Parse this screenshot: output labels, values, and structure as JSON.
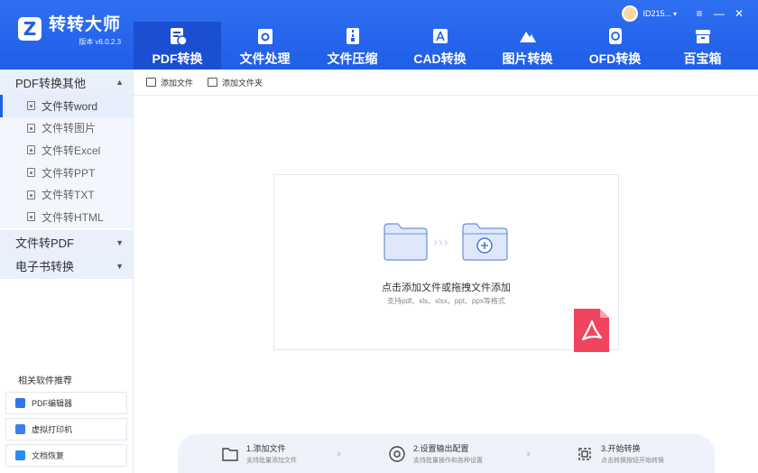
{
  "app": {
    "name": "转转大师",
    "version": "版本 v6.0.2.3",
    "logo_letter": "Z"
  },
  "user": {
    "id": "ID215...",
    "dropdown": "▾"
  },
  "window": {
    "menu": "≡",
    "minimize": "—",
    "close": "✕"
  },
  "nav_tabs": [
    {
      "label": "PDF转换",
      "icon": "pdf-convert-icon",
      "active": true
    },
    {
      "label": "文件处理",
      "icon": "file-process-icon"
    },
    {
      "label": "文件压缩",
      "icon": "file-compress-icon"
    },
    {
      "label": "CAD转换",
      "icon": "cad-icon"
    },
    {
      "label": "图片转换",
      "icon": "image-icon"
    },
    {
      "label": "OFD转换",
      "icon": "ofd-icon"
    },
    {
      "label": "百宝箱",
      "icon": "toolbox-icon"
    }
  ],
  "sidebar": {
    "groups": [
      {
        "label": "PDF转换其他",
        "caret": "▲",
        "items": [
          {
            "label": "文件转word",
            "active": true
          },
          {
            "label": "文件转图片"
          },
          {
            "label": "文件转Excel"
          },
          {
            "label": "文件转PPT"
          },
          {
            "label": "文件转TXT"
          },
          {
            "label": "文件转HTML"
          }
        ]
      },
      {
        "label": "文件转PDF",
        "caret": "▼"
      },
      {
        "label": "电子书转换",
        "caret": "▼"
      }
    ],
    "related_title": "相关软件推荐",
    "related": [
      {
        "label": "PDF编辑器",
        "color": "#2f74f0"
      },
      {
        "label": "虚拟打印机",
        "color": "#3b7df2"
      },
      {
        "label": "文档恢复",
        "color": "#2a8cf0"
      }
    ]
  },
  "toolbar": {
    "add_file": "添加文件",
    "add_folder": "添加文件夹"
  },
  "dropzone": {
    "main_text": "点击添加文件或拖拽文件添加",
    "sub_text": "支持pdf、xls、xlsx、ppt、ppx等格式",
    "arrows": "›››"
  },
  "steps": [
    {
      "title": "1.添加文件",
      "sub": "支持批量添加文件"
    },
    {
      "title": "2.设置输出配置",
      "sub": "支持批量操作和各种设置"
    },
    {
      "title": "3.开始转换",
      "sub": "点击转换按钮开始转换"
    }
  ],
  "step_arrow": "››",
  "colors": {
    "brand": "#1f5ee8",
    "active_tab": "#1a4fd1",
    "pdf_badge": "#f0455e",
    "folder": "#dfe8fb",
    "folder_stroke": "#6b8fd6"
  }
}
